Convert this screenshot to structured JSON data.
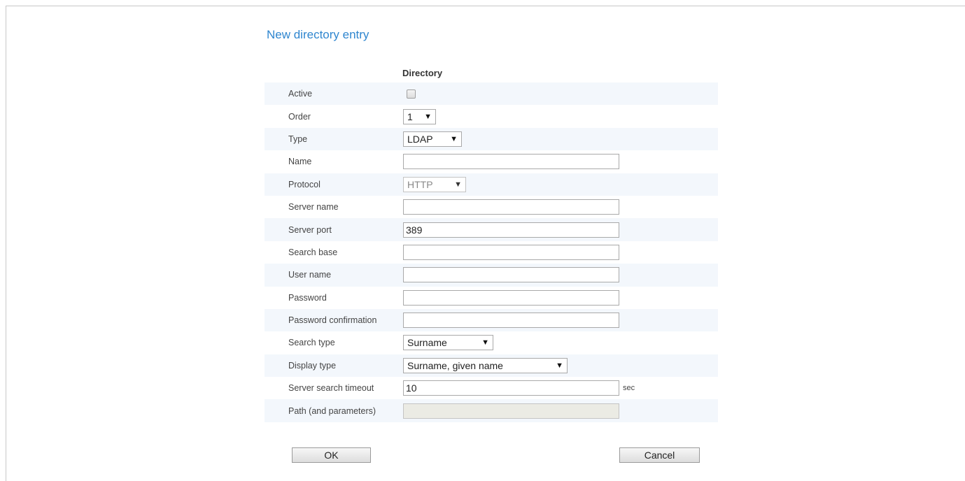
{
  "page": {
    "title": "New directory entry",
    "section_header": "Directory"
  },
  "fields": {
    "active": {
      "label": "Active",
      "checked": false
    },
    "order": {
      "label": "Order",
      "value": "1"
    },
    "type": {
      "label": "Type",
      "value": "LDAP"
    },
    "name": {
      "label": "Name",
      "value": ""
    },
    "protocol": {
      "label": "Protocol",
      "value": "HTTP",
      "disabled": true
    },
    "server_name": {
      "label": "Server name",
      "value": ""
    },
    "server_port": {
      "label": "Server port",
      "value": "389"
    },
    "search_base": {
      "label": "Search base",
      "value": ""
    },
    "user_name": {
      "label": "User name",
      "value": ""
    },
    "password": {
      "label": "Password",
      "value": ""
    },
    "password_confirmation": {
      "label": "Password confirmation",
      "value": ""
    },
    "search_type": {
      "label": "Search type",
      "value": "Surname"
    },
    "display_type": {
      "label": "Display type",
      "value": "Surname, given name"
    },
    "server_search_timeout": {
      "label": "Server search timeout",
      "value": "10",
      "unit": "sec"
    },
    "path": {
      "label": "Path (and parameters)",
      "value": "",
      "disabled": true
    }
  },
  "buttons": {
    "ok": "OK",
    "cancel": "Cancel"
  },
  "colors": {
    "title": "#2f86cf",
    "row_stripe": "#f3f7fc",
    "disabled_input": "#ebebe4"
  }
}
